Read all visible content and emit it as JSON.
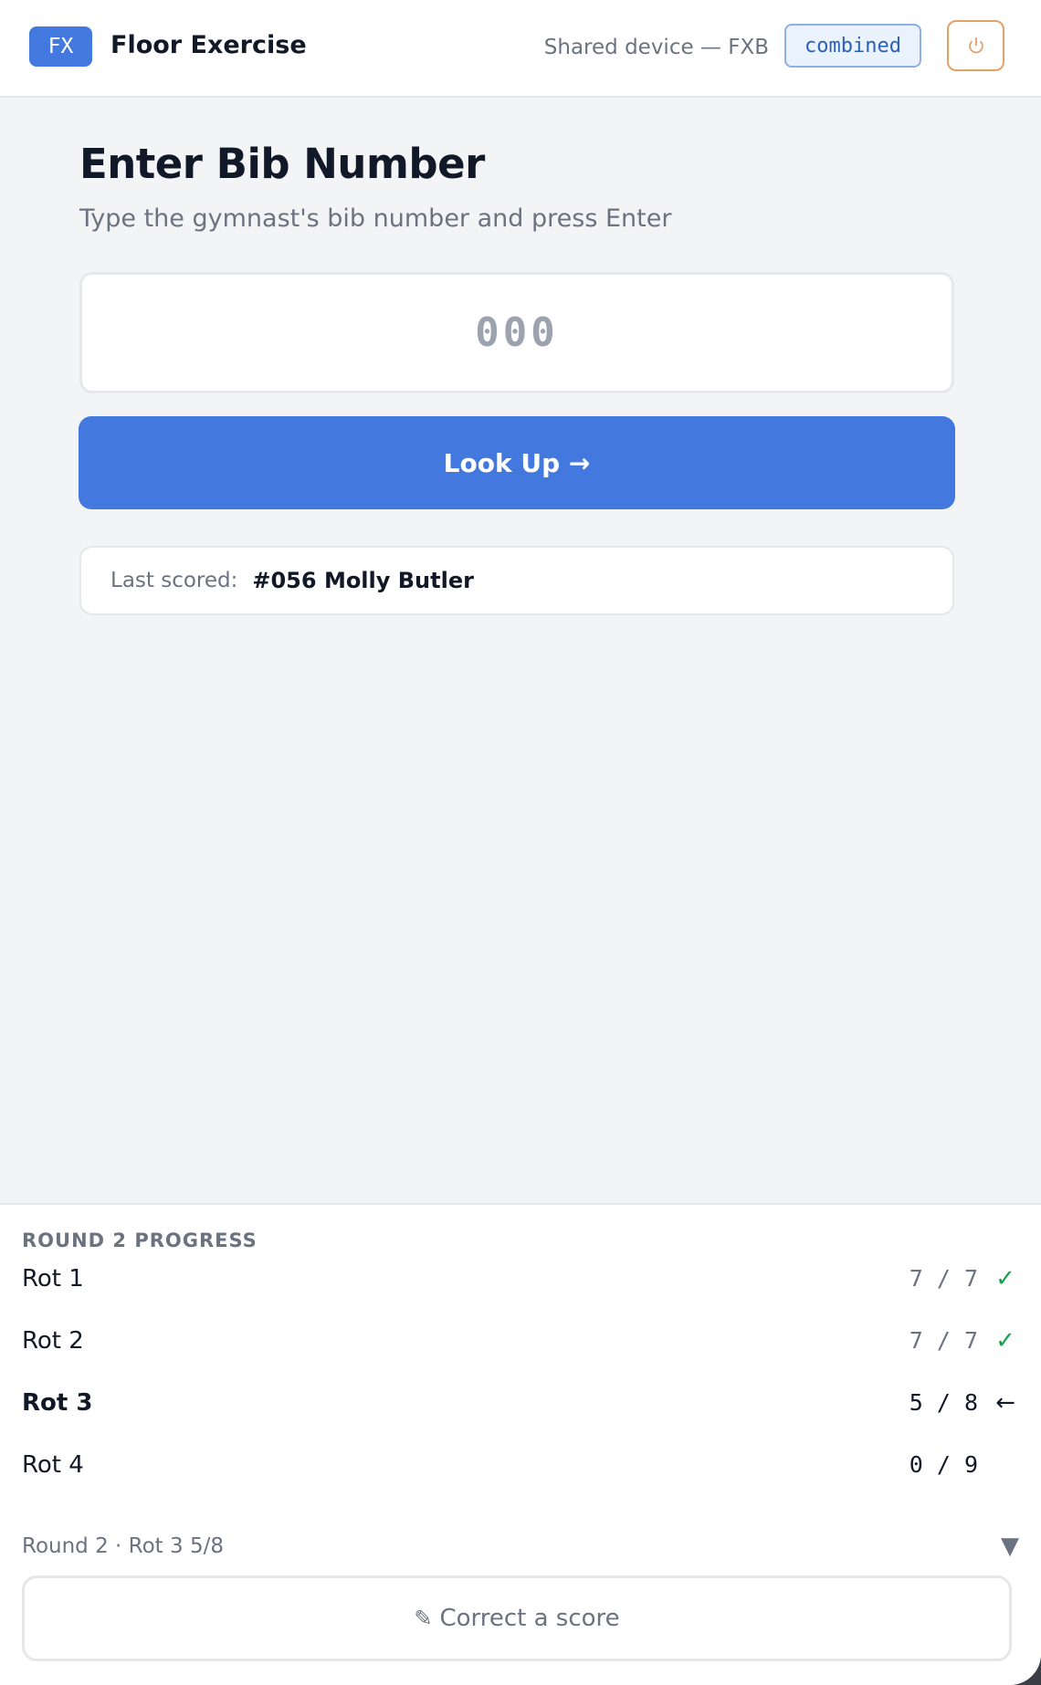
{
  "header": {
    "badge": "FX",
    "title": "Floor Exercise",
    "device_label": "Shared device — FXB",
    "mode_badge": "combined",
    "power_icon": "power-icon"
  },
  "main": {
    "title": "Enter Bib Number",
    "subtitle": "Type the gymnast's bib number and press Enter",
    "bib_input": {
      "value": "",
      "placeholder": "000"
    },
    "lookup_button": "Look Up →",
    "last_scored": {
      "label": "Last scored:",
      "value": "#056 Molly Butler"
    }
  },
  "progress": {
    "heading": "ROUND 2 PROGRESS",
    "rotations": [
      {
        "label": "Rot 1",
        "count": "7 / 7",
        "status": "✓"
      },
      {
        "label": "Rot 2",
        "count": "7 / 7",
        "status": "✓"
      },
      {
        "label": "Rot 3",
        "count": "5 / 8",
        "status": "←"
      },
      {
        "label": "Rot 4",
        "count": "0 / 9",
        "status": ""
      }
    ],
    "summary": "Round 2 · Rot 3 5/8",
    "toggle": "▼",
    "correct_button": {
      "icon": "✎",
      "label": "Correct a score"
    }
  },
  "colors": {
    "accent": "#4379df",
    "success": "#16a34a",
    "power_border": "#e2a168"
  }
}
